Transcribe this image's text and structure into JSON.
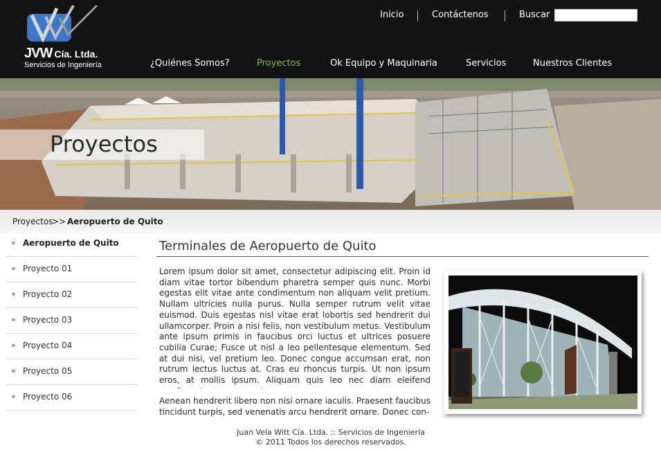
{
  "header": {
    "logo_text": "JVW",
    "logo_small": "Cía. Ltda.",
    "logo_sub": "Servicios de Ingeniería",
    "top_links": [
      "Inicio",
      "Contáctenos",
      "Buscar"
    ],
    "search_placeholder": "",
    "nav": [
      {
        "label": "¿Quiénes Somos?",
        "active": false
      },
      {
        "label": "Proyectos",
        "active": true
      },
      {
        "label": "Ok Equipo y Maquinaria",
        "active": false
      },
      {
        "label": "Servicios",
        "active": false
      },
      {
        "label": "Nuestros Clientes",
        "active": false
      }
    ]
  },
  "banner": {
    "title": "Proyectos"
  },
  "breadcrumb": {
    "parent": "Proyectos",
    "separator": ">>",
    "current": "Aeropuerto de Quito"
  },
  "sidebar": {
    "bullet": "»",
    "items": [
      {
        "label": "Aeropuerto de Quito",
        "active": true
      },
      {
        "label": "Proyecto 01",
        "active": false
      },
      {
        "label": "Proyecto 02",
        "active": false
      },
      {
        "label": "Proyecto 03",
        "active": false
      },
      {
        "label": "Proyecto 04",
        "active": false
      },
      {
        "label": "Proyecto 05",
        "active": false
      },
      {
        "label": "Proyecto 06",
        "active": false
      }
    ]
  },
  "content": {
    "title": "Terminales de Aeropuerto de Quito",
    "paragraphs": [
      "Lorem ipsum dolor sit amet, consectetur adipiscing elit. Proin id diam vitae tortor bibendum pharetra semper quis nunc. Morbi egestas elit vitae ante condimentum non aliquam velit pretium. Nullam ultricies nulla purus. Nulla semper rutrum velit vitae euismod. Duis egestas nisl vitae erat lobortis sed hendrerit dui ullamcorper. Proin a nisi felis, non vestibulum metus. Vestibulum ante ipsum primis in faucibus orci luctus et ultrices posuere cubilia Curae; Fusce ut nisl a leo pellentesque elementum. Sed at dui nisi, vel pretium leo. Donec congue accumsan erat, non rutrum lectus luctus at. Cras eu rhoncus turpis. Ut non ipsum eros, at mollis ipsum. Aliquam quis leo nec diam eleifend condimentum nec eu ante.",
      "Aenean hendrerit libero non nisi ornare iaculis. Praesent faucibus tincidunt turpis, sed venenatis arcu hendrerit ornare. Donec con-"
    ]
  },
  "footer": {
    "line1": "Juan Vela Witt Cía. Ltda. :: Servicios de Ingeniería",
    "line2": "© 2011 Todos los derechos reservados."
  },
  "colors": {
    "header_bg": "#131313",
    "nav_active": "#7fbf3f",
    "logo_blue": "#3c78c8"
  }
}
